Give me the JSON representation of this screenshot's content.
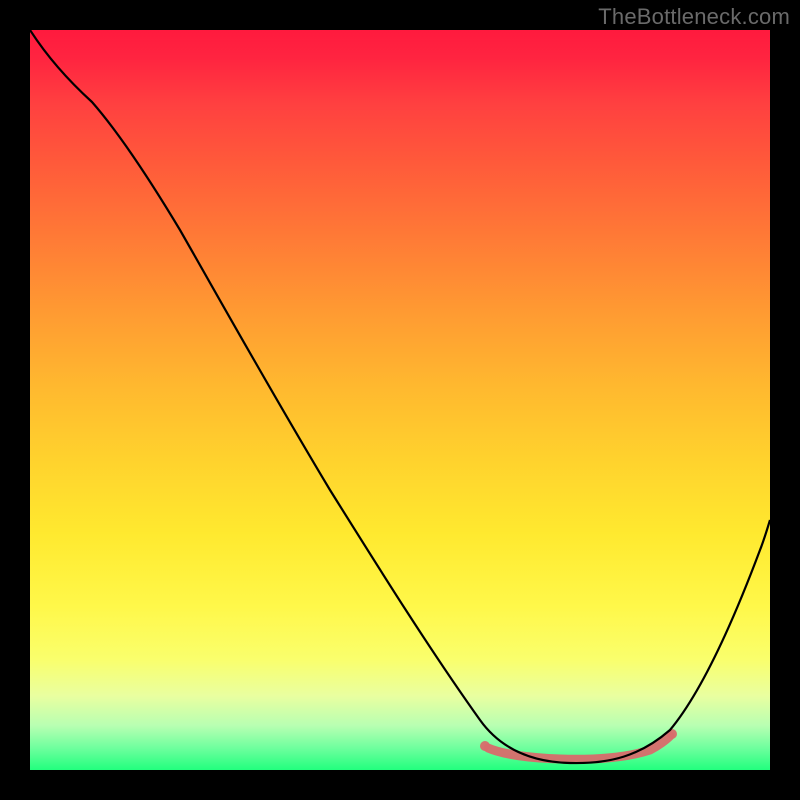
{
  "watermark": "TheBottleneck.com",
  "colors": {
    "background": "#000000",
    "curve": "#000000",
    "accent": "#d86b6b",
    "watermark_text": "#6a6a6a"
  },
  "chart_data": {
    "type": "line",
    "title": "",
    "xlabel": "",
    "ylabel": "",
    "xlim": [
      0,
      100
    ],
    "ylim": [
      0,
      100
    ],
    "grid": false,
    "legend": false,
    "series": [
      {
        "name": "bottleneck-curve",
        "x": [
          0,
          3,
          8,
          14,
          20,
          27,
          34,
          42,
          50,
          57,
          62,
          66,
          70,
          73,
          76,
          80,
          84,
          88,
          92,
          96,
          100
        ],
        "y": [
          100,
          97,
          93,
          87,
          79,
          69,
          59,
          47,
          35,
          24,
          16,
          10,
          5,
          2,
          1,
          1,
          3,
          8,
          16,
          27,
          40
        ]
      }
    ],
    "accent_region": {
      "name": "optimal-zone",
      "x_start": 62,
      "x_end": 86,
      "y": 1
    },
    "gradient_stops": [
      {
        "pos": 0.0,
        "color": "#ff1a3e"
      },
      {
        "pos": 0.1,
        "color": "#ff4040"
      },
      {
        "pos": 0.28,
        "color": "#ff7a36"
      },
      {
        "pos": 0.48,
        "color": "#ffb82f"
      },
      {
        "pos": 0.68,
        "color": "#ffe92f"
      },
      {
        "pos": 0.85,
        "color": "#faff6c"
      },
      {
        "pos": 0.94,
        "color": "#b8ffb2"
      },
      {
        "pos": 1.0,
        "color": "#22ff7e"
      }
    ]
  }
}
